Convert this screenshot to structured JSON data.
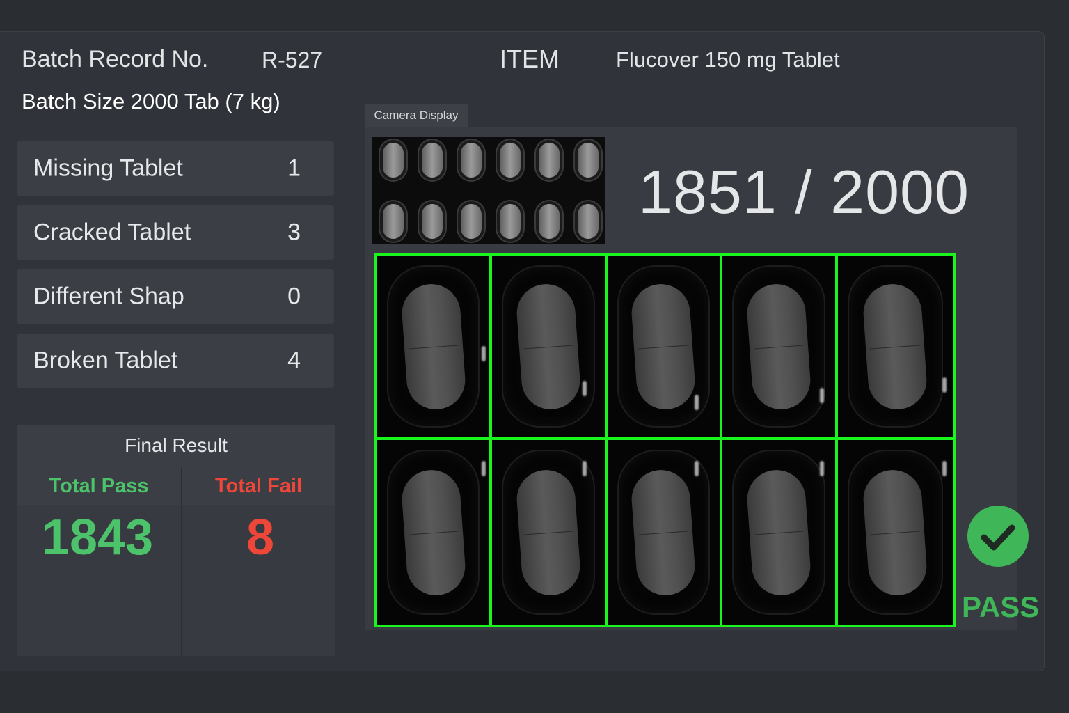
{
  "header": {
    "batch_record_label": "Batch Record No.",
    "batch_record_value": "R-527",
    "item_label": "ITEM",
    "item_value": "Flucover 150 mg Tablet",
    "batch_size": "Batch Size 2000 Tab (7 kg)"
  },
  "defects": [
    {
      "label": "Missing Tablet",
      "count": "1"
    },
    {
      "label": "Cracked Tablet",
      "count": "3"
    },
    {
      "label": "Different Shap",
      "count": "0"
    },
    {
      "label": "Broken Tablet",
      "count": "4"
    }
  ],
  "final_result": {
    "title": "Final Result",
    "pass_label": "Total Pass",
    "fail_label": "Total Fail",
    "pass_value": "1843",
    "fail_value": "8"
  },
  "camera": {
    "tab_label": "Camera Display",
    "counter": "1851 / 2000",
    "inspected": 1851,
    "total": 2000,
    "grid_rows": 2,
    "grid_cols": 5
  },
  "status": {
    "label": "PASS",
    "icon": "check-circle-icon"
  },
  "colors": {
    "pass": "#4cc36a",
    "fail": "#ee4638",
    "grid_outline": "#19f51d"
  }
}
